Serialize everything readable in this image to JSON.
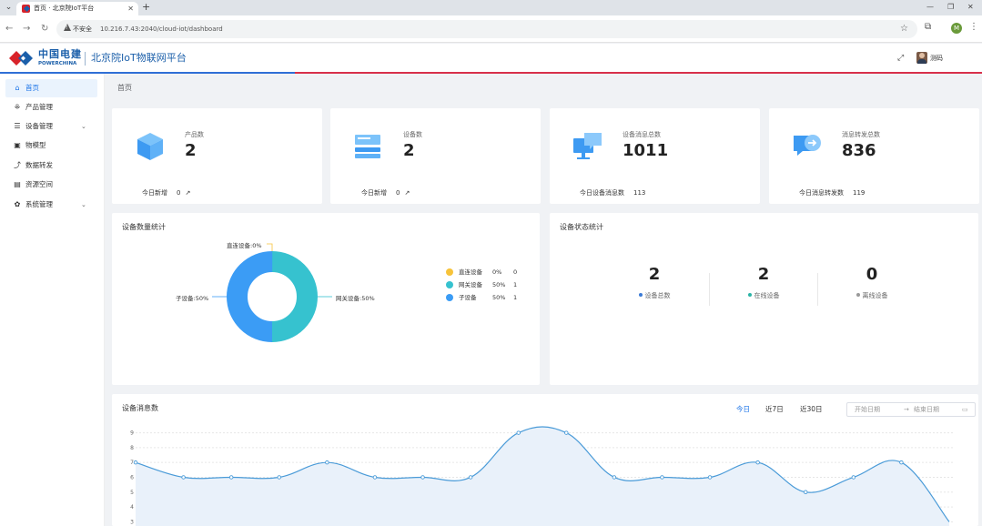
{
  "browser": {
    "tab_title": "首页 · 北京院IoT平台",
    "security_label": "不安全",
    "url": "10.216.7.43:2040/cloud-iot/dashboard",
    "profile_initial": "M"
  },
  "header": {
    "logo_cn": "中国电建",
    "logo_en": "POWERCHINA",
    "platform_title": "北京院IoT物联网平台",
    "username": "测码"
  },
  "sidebar": {
    "items": [
      {
        "label": "首页",
        "icon": "home-icon",
        "active": true
      },
      {
        "label": "产品管理",
        "icon": "product-icon"
      },
      {
        "label": "设备管理",
        "icon": "device-icon",
        "expandable": true
      },
      {
        "label": "物模型",
        "icon": "model-icon"
      },
      {
        "label": "数据转发",
        "icon": "forward-icon"
      },
      {
        "label": "资源空间",
        "icon": "resource-icon"
      },
      {
        "label": "系统管理",
        "icon": "settings-icon",
        "expandable": true
      }
    ]
  },
  "breadcrumb": "首页",
  "stats": [
    {
      "label": "产品数",
      "value": "2",
      "foot_label": "今日新增",
      "foot_value": "0",
      "icon": "cube-icon"
    },
    {
      "label": "设备数",
      "value": "2",
      "foot_label": "今日新增",
      "foot_value": "0",
      "icon": "server-icon"
    },
    {
      "label": "设备消息总数",
      "value": "1011",
      "foot_label": "今日设备消息数",
      "foot_value": "113",
      "icon": "monitor-chat-icon"
    },
    {
      "label": "消息转发总数",
      "value": "836",
      "foot_label": "今日消息转发数",
      "foot_value": "119",
      "icon": "forward-chat-icon"
    }
  ],
  "device_count_panel": {
    "title": "设备数量统计",
    "callouts": {
      "direct": "直连设备:0%",
      "gateway": "网关设备:50%",
      "sub": "子设备:50%"
    },
    "legend": [
      {
        "name": "直连设备",
        "pct": "0%",
        "count": "0",
        "color": "#f7c33a"
      },
      {
        "name": "网关设备",
        "pct": "50%",
        "count": "1",
        "color": "#36c2cf"
      },
      {
        "name": "子设备",
        "pct": "50%",
        "count": "1",
        "color": "#3b9cf5"
      }
    ]
  },
  "device_status_panel": {
    "title": "设备状态统计",
    "items": [
      {
        "value": "2",
        "label": "设备总数",
        "color": "#3b7bd6"
      },
      {
        "value": "2",
        "label": "在线设备",
        "color": "#2bb4a6"
      },
      {
        "value": "0",
        "label": "离线设备",
        "color": "#999999"
      }
    ]
  },
  "message_panel": {
    "title": "设备消息数",
    "range_tabs": [
      "今日",
      "近7日",
      "近30日"
    ],
    "active_range": "今日",
    "date_start_placeholder": "开始日期",
    "date_sep": "→",
    "date_end_placeholder": "结束日期"
  },
  "chart_data": {
    "type": "area",
    "title": "设备消息数",
    "y_ticks": [
      3,
      4,
      5,
      6,
      7,
      8,
      9
    ],
    "ylim": [
      3,
      9.4
    ],
    "grid": true,
    "series": [
      {
        "values": [
          7,
          6,
          6,
          6,
          7,
          6,
          6,
          6,
          9,
          9,
          6,
          6,
          6,
          7,
          5,
          6,
          7,
          3
        ]
      }
    ],
    "color": "#4a9bd8"
  }
}
